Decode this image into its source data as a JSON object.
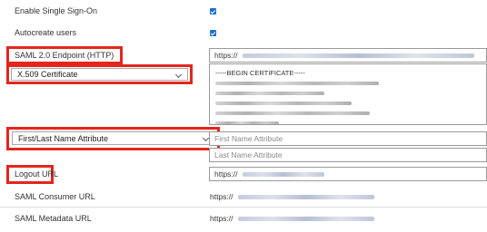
{
  "rows": {
    "enable_sso": {
      "label": "Enable Single Sign-On",
      "checked": true
    },
    "autocreate": {
      "label": "Autocreate users",
      "checked": true
    },
    "saml_endpoint": {
      "label": "SAML 2.0 Endpoint (HTTP)",
      "value": "https://"
    },
    "x509": {
      "label": "X.509 Certificate",
      "value_first_line": "-----BEGIN CERTIFICATE-----"
    },
    "name_attr": {
      "label": "First/Last Name Attribute",
      "first_placeholder": "First Name Attribute",
      "last_placeholder": "Last Name Attribute"
    },
    "logout": {
      "label": "Logout URL",
      "value": "https://"
    },
    "consumer": {
      "label": "SAML Consumer URL",
      "value": "https://"
    },
    "metadata": {
      "label": "SAML Metadata URL",
      "value": "https://"
    }
  },
  "colors": {
    "highlight": "#e3261c",
    "checkbox": "#1f6fd1"
  },
  "icons": {
    "checkbox": "checkmark-icon",
    "dropdown": "chevron-down-icon"
  }
}
